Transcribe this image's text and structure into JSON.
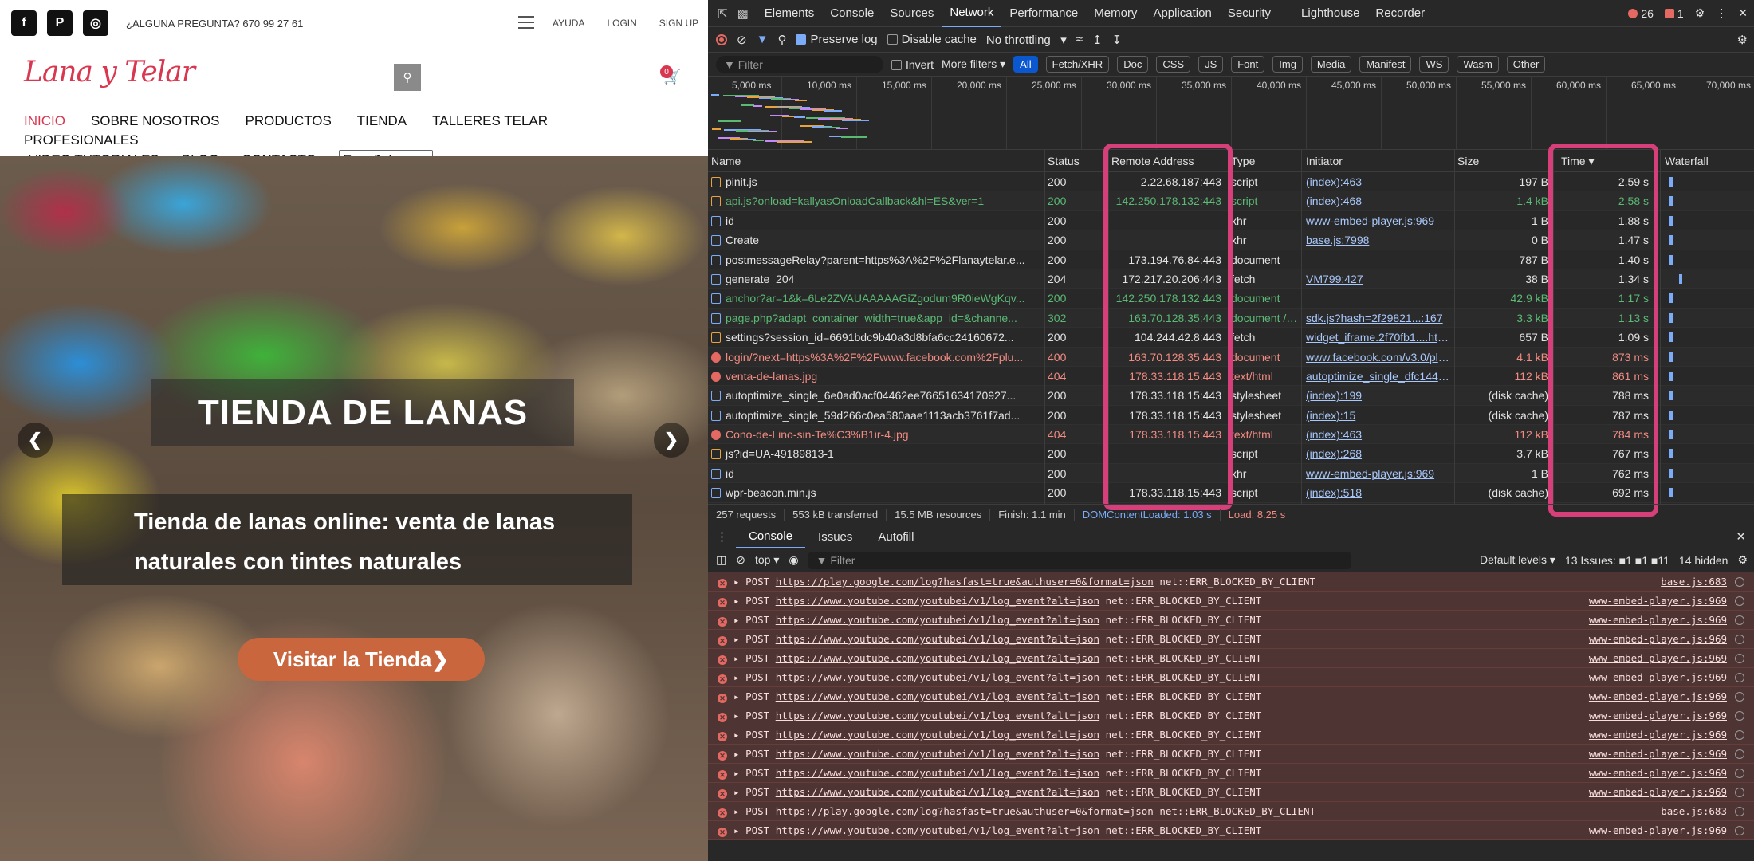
{
  "site": {
    "social": [
      "f",
      "P",
      "◎"
    ],
    "question": "¿ALGUNA PREGUNTA? 670 99 27 61",
    "toplinks": [
      "AYUDA",
      "LOGIN",
      "SIGN UP"
    ],
    "logo": "Lana y Telar",
    "cart_count": "0",
    "nav_row1": [
      "INICIO",
      "SOBRE NOSOTROS",
      "PRODUCTOS",
      "TIENDA",
      "TALLERES TELAR",
      "PROFESIONALES"
    ],
    "nav_row2": [
      "VIDEO TUTORIALES",
      "BLOG",
      "CONTACTO"
    ],
    "language": "Español",
    "hero_title": "TIENDA DE LANAS",
    "hero_subtitle": "Tienda de lanas online: venta de lanas naturales con tintes naturales",
    "hero_button": "Visitar la Tienda❯",
    "accent": "#d9364f"
  },
  "devtools": {
    "tabs": [
      "Elements",
      "Console",
      "Sources",
      "Network",
      "Performance",
      "Memory",
      "Application",
      "Security",
      "Lighthouse",
      "Recorder"
    ],
    "active_tab": "Network",
    "errors": "26",
    "warnings": "1",
    "toolbar": {
      "preserve_log": "Preserve log",
      "disable_cache": "Disable cache",
      "throttling": "No throttling"
    },
    "filter_placeholder": "Filter",
    "invert": "Invert",
    "more_filters": "More filters ▾",
    "chips": [
      "All",
      "Fetch/XHR",
      "Doc",
      "CSS",
      "JS",
      "Font",
      "Img",
      "Media",
      "Manifest",
      "WS",
      "Wasm",
      "Other"
    ],
    "timeline_labels": [
      "5,000 ms",
      "10,000 ms",
      "15,000 ms",
      "20,000 ms",
      "25,000 ms",
      "30,000 ms",
      "35,000 ms",
      "40,000 ms",
      "45,000 ms",
      "50,000 ms",
      "55,000 ms",
      "60,000 ms",
      "65,000 ms",
      "70,000 ms"
    ],
    "columns": [
      "Name",
      "Status",
      "Remote Address",
      "Type",
      "Initiator",
      "Size",
      "Time ▾",
      "Waterfall"
    ],
    "rows": [
      {
        "icon": "js",
        "name": "pinit.js",
        "status": "200",
        "addr": "2.22.68.187:443",
        "type": "script",
        "init": "(index):463",
        "size": "197 B",
        "time": "2.59 s",
        "cls": ""
      },
      {
        "icon": "js",
        "name": "api.js?onload=kallyasOnloadCallback&hl=ES&ver=1",
        "status": "200",
        "addr": "142.250.178.132:443",
        "type": "script",
        "init": "(index):468",
        "size": "1.4 kB",
        "time": "2.58 s",
        "cls": "green"
      },
      {
        "icon": "doc",
        "name": "id",
        "status": "200",
        "addr": "",
        "type": "xhr",
        "init": "www-embed-player.js:969",
        "size": "1 B",
        "time": "1.88 s",
        "cls": ""
      },
      {
        "icon": "doc",
        "name": "Create",
        "status": "200",
        "addr": "",
        "type": "xhr",
        "init": "base.js:7998",
        "size": "0 B",
        "time": "1.47 s",
        "cls": ""
      },
      {
        "icon": "doc",
        "name": "postmessageRelay?parent=https%3A%2F%2Flanaytelar.e...",
        "status": "200",
        "addr": "173.194.76.84:443",
        "type": "document",
        "init": "",
        "size": "787 B",
        "time": "1.40 s",
        "cls": ""
      },
      {
        "icon": "doc",
        "name": "generate_204",
        "status": "204",
        "addr": "172.217.20.206:443",
        "type": "fetch",
        "init": "VM799:427",
        "size": "38 B",
        "time": "1.34 s",
        "cls": ""
      },
      {
        "icon": "doc",
        "name": "anchor?ar=1&k=6Le2ZVAUAAAAAGiZgodum9R0ieWgKqv...",
        "status": "200",
        "addr": "142.250.178.132:443",
        "type": "document",
        "init": "",
        "size": "42.9 kB",
        "time": "1.17 s",
        "cls": "green"
      },
      {
        "icon": "doc",
        "name": "page.php?adapt_container_width=true&app_id=&channe...",
        "status": "302",
        "addr": "163.70.128.35:443",
        "type": "document / ...",
        "init": "sdk.js?hash=2f29821...:167",
        "size": "3.3 kB",
        "time": "1.13 s",
        "cls": "green"
      },
      {
        "icon": "js",
        "name": "settings?session_id=6691bdc9b40a3d8bfa6cc24160672...",
        "status": "200",
        "addr": "104.244.42.8:443",
        "type": "fetch",
        "init": "widget_iframe.2f70fb1....html?",
        "size": "657 B",
        "time": "1.09 s",
        "cls": ""
      },
      {
        "icon": "err",
        "name": "login/?next=https%3A%2F%2Fwww.facebook.com%2Fplu...",
        "status": "400",
        "addr": "163.70.128.35:443",
        "type": "document",
        "init": "www.facebook.com/v3.0/plugi",
        "size": "4.1 kB",
        "time": "873 ms",
        "cls": "red"
      },
      {
        "icon": "err",
        "name": "venta-de-lanas.jpg",
        "status": "404",
        "addr": "178.33.118.15:443",
        "type": "text/html",
        "init": "autoptimize_single_dfc1449...",
        "size": "112 kB",
        "time": "861 ms",
        "cls": "red"
      },
      {
        "icon": "doc",
        "name": "autoptimize_single_6e0ad0acf04462ee76651634170927...",
        "status": "200",
        "addr": "178.33.118.15:443",
        "type": "stylesheet",
        "init": "(index):199",
        "size": "(disk cache)",
        "time": "788 ms",
        "cls": ""
      },
      {
        "icon": "doc",
        "name": "autoptimize_single_59d266c0ea580aae1113acb3761f7ad...",
        "status": "200",
        "addr": "178.33.118.15:443",
        "type": "stylesheet",
        "init": "(index):15",
        "size": "(disk cache)",
        "time": "787 ms",
        "cls": ""
      },
      {
        "icon": "err",
        "name": "Cono-de-Lino-sin-Te%C3%B1ir-4.jpg",
        "status": "404",
        "addr": "178.33.118.15:443",
        "type": "text/html",
        "init": "(index):463",
        "size": "112 kB",
        "time": "784 ms",
        "cls": "red"
      },
      {
        "icon": "js",
        "name": "js?id=UA-49189813-1",
        "status": "200",
        "addr": "",
        "type": "script",
        "init": "(index):268",
        "size": "3.7 kB",
        "time": "767 ms",
        "cls": ""
      },
      {
        "icon": "doc",
        "name": "id",
        "status": "200",
        "addr": "",
        "type": "xhr",
        "init": "www-embed-player.js:969",
        "size": "1 B",
        "time": "762 ms",
        "cls": ""
      },
      {
        "icon": "doc",
        "name": "wpr-beacon.min.js",
        "status": "200",
        "addr": "178.33.118.15:443",
        "type": "script",
        "init": "(index):518",
        "size": "(disk cache)",
        "time": "692 ms",
        "cls": ""
      }
    ],
    "status": [
      "257 requests",
      "553 kB transferred",
      "15.5 MB resources",
      "Finish: 1.1 min",
      "DOMContentLoaded: 1.03 s",
      "Load: 8.25 s"
    ],
    "console_tabs": [
      "Console",
      "Issues",
      "Autofill"
    ],
    "console_context": "top ▾",
    "console_filter": "Filter",
    "levels": "Default levels ▾",
    "issues": "13 Issues: ■1 ■1 ■11",
    "hidden": "14 hidden",
    "logs": [
      {
        "method": "POST",
        "url": "https://play.google.com/log?hasfast=true&authuser=0&format=json",
        "err": "net::ERR_BLOCKED_BY_CLIENT",
        "src": "base.js:683"
      },
      {
        "method": "POST",
        "url": "https://www.youtube.com/youtubei/v1/log_event?alt=json",
        "err": "net::ERR_BLOCKED_BY_CLIENT",
        "src": "www-embed-player.js:969"
      },
      {
        "method": "POST",
        "url": "https://www.youtube.com/youtubei/v1/log_event?alt=json",
        "err": "net::ERR_BLOCKED_BY_CLIENT",
        "src": "www-embed-player.js:969"
      },
      {
        "method": "POST",
        "url": "https://www.youtube.com/youtubei/v1/log_event?alt=json",
        "err": "net::ERR_BLOCKED_BY_CLIENT",
        "src": "www-embed-player.js:969"
      },
      {
        "method": "POST",
        "url": "https://www.youtube.com/youtubei/v1/log_event?alt=json",
        "err": "net::ERR_BLOCKED_BY_CLIENT",
        "src": "www-embed-player.js:969"
      },
      {
        "method": "POST",
        "url": "https://www.youtube.com/youtubei/v1/log_event?alt=json",
        "err": "net::ERR_BLOCKED_BY_CLIENT",
        "src": "www-embed-player.js:969"
      },
      {
        "method": "POST",
        "url": "https://www.youtube.com/youtubei/v1/log_event?alt=json",
        "err": "net::ERR_BLOCKED_BY_CLIENT",
        "src": "www-embed-player.js:969"
      },
      {
        "method": "POST",
        "url": "https://www.youtube.com/youtubei/v1/log_event?alt=json",
        "err": "net::ERR_BLOCKED_BY_CLIENT",
        "src": "www-embed-player.js:969"
      },
      {
        "method": "POST",
        "url": "https://www.youtube.com/youtubei/v1/log_event?alt=json",
        "err": "net::ERR_BLOCKED_BY_CLIENT",
        "src": "www-embed-player.js:969"
      },
      {
        "method": "POST",
        "url": "https://www.youtube.com/youtubei/v1/log_event?alt=json",
        "err": "net::ERR_BLOCKED_BY_CLIENT",
        "src": "www-embed-player.js:969"
      },
      {
        "method": "POST",
        "url": "https://www.youtube.com/youtubei/v1/log_event?alt=json",
        "err": "net::ERR_BLOCKED_BY_CLIENT",
        "src": "www-embed-player.js:969"
      },
      {
        "method": "POST",
        "url": "https://www.youtube.com/youtubei/v1/log_event?alt=json",
        "err": "net::ERR_BLOCKED_BY_CLIENT",
        "src": "www-embed-player.js:969"
      },
      {
        "method": "POST",
        "url": "https://play.google.com/log?hasfast=true&authuser=0&format=json",
        "err": "net::ERR_BLOCKED_BY_CLIENT",
        "src": "base.js:683"
      },
      {
        "method": "POST",
        "url": "https://www.youtube.com/youtubei/v1/log_event?alt=json",
        "err": "net::ERR_BLOCKED_BY_CLIENT",
        "src": "www-embed-player.js:969"
      }
    ]
  }
}
